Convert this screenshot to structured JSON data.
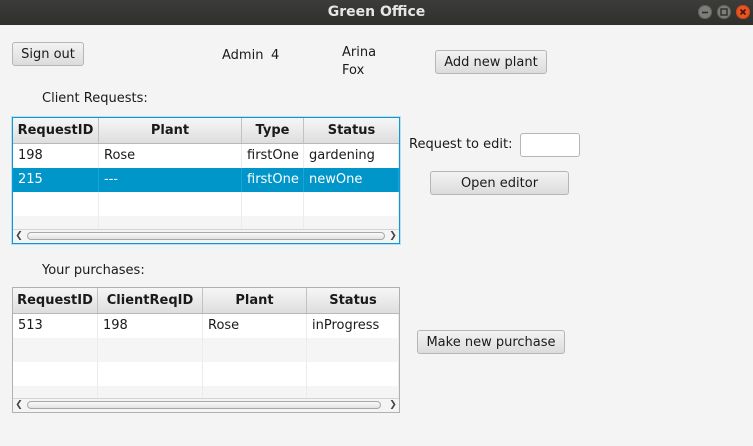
{
  "window": {
    "title": "Green Office"
  },
  "header": {
    "sign_out_label": "Sign out",
    "role": "Admin",
    "user_id": "4",
    "first_name": "Arina",
    "last_name": "Fox",
    "add_plant_label": "Add new plant"
  },
  "client_requests": {
    "title": "Client Requests:",
    "columns": [
      "RequestID",
      "Plant",
      "Type",
      "Status"
    ],
    "rows": [
      [
        "198",
        "Rose",
        "firstOne",
        "gardening"
      ],
      [
        "215",
        "---",
        "firstOne",
        "newOne"
      ]
    ],
    "selected_row": 1
  },
  "editor": {
    "request_label": "Request to edit:",
    "request_value": "",
    "open_editor_label": "Open editor"
  },
  "purchases": {
    "title": "Your purchases:",
    "columns": [
      "RequestID",
      "ClientReqID",
      "Plant",
      "Status"
    ],
    "rows": [
      [
        "513",
        "198",
        "Rose",
        "inProgress"
      ]
    ],
    "new_purchase_label": "Make new purchase"
  },
  "colors": {
    "selection": "#0096c9",
    "focus_border": "#0f97cf",
    "title_bar": "#2f2f2d",
    "close_button": "#e95420"
  }
}
